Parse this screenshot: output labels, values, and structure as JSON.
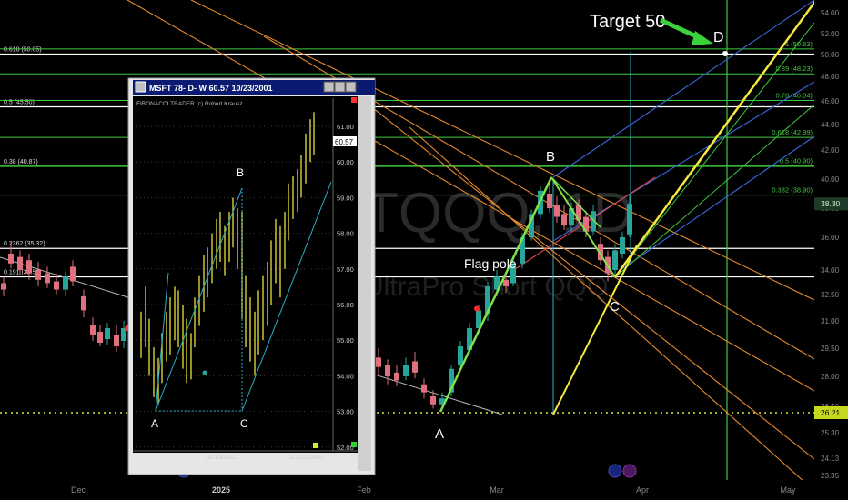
{
  "chart_data": {
    "type": "candlestick",
    "watermark": "TQQQ, 1D",
    "watermark_sub": "UltraPro Short QQQ",
    "right_axis_ticks": [
      "54.00",
      "52.00",
      "50.00",
      "48.00",
      "46.00",
      "44.00",
      "42.00",
      "40.00",
      "38.00",
      "36.00",
      "34.00",
      "32.50",
      "31.00",
      "29.50",
      "28.00",
      "26.50",
      "25.30",
      "24.13",
      "23.35"
    ],
    "x_axis_labels": [
      "Dec",
      "2025",
      "Feb",
      "Mar",
      "Apr",
      "May"
    ],
    "last_price": "38.30",
    "baseline_price": "26.21",
    "left_levels": [
      {
        "label": "0.618 (50.05)",
        "price": 50.05
      },
      {
        "label": "0.5 (45.50)",
        "price": 45.5
      },
      {
        "label": "0.38 (40.87)",
        "price": 40.87
      },
      {
        "label": "0.2362 (35.32)",
        "price": 35.32
      },
      {
        "label": "0.191 (33.58)",
        "price": 33.58
      }
    ],
    "right_levels": [
      {
        "label": "1 (50.53)",
        "price": 50.53
      },
      {
        "label": "0.89 (48.23)",
        "price": 48.23
      },
      {
        "label": "0.78 (46.04)",
        "price": 46.04
      },
      {
        "label": "0.618 (42.99)",
        "price": 42.99
      },
      {
        "label": "0.5 (40.90)",
        "price": 40.9
      },
      {
        "label": "0.382 (38.90)",
        "price": 38.9
      }
    ],
    "annotations": {
      "target": "Target 50",
      "flag_pole": "Flag pole",
      "A": "A",
      "B": "B",
      "C": "C",
      "D": "D"
    }
  },
  "inset": {
    "title": "MSFT  78- D- W 60.57 10/23/2001",
    "subtitle": "FIBONACCI TRADER (c) Robert Krausz",
    "price_tag": "60.57",
    "y_ticks": [
      "61.00",
      "60.00",
      "59.00",
      "58.00",
      "57.00",
      "56.00",
      "55.00",
      "54.00",
      "53.00",
      "52.00"
    ],
    "x_labels": [
      "10/15/2001",
      "10/22/2001"
    ],
    "points": {
      "A": "A",
      "B": "B",
      "C": "C"
    }
  },
  "colors": {
    "up": "#26a69a",
    "down": "#ef5350",
    "fib_green": "#3ec93e",
    "orange": "#e58a2e",
    "yellow": "#f5e840",
    "blue": "#3b67e0",
    "cyan": "#27b0c8",
    "white": "#ffffff"
  }
}
